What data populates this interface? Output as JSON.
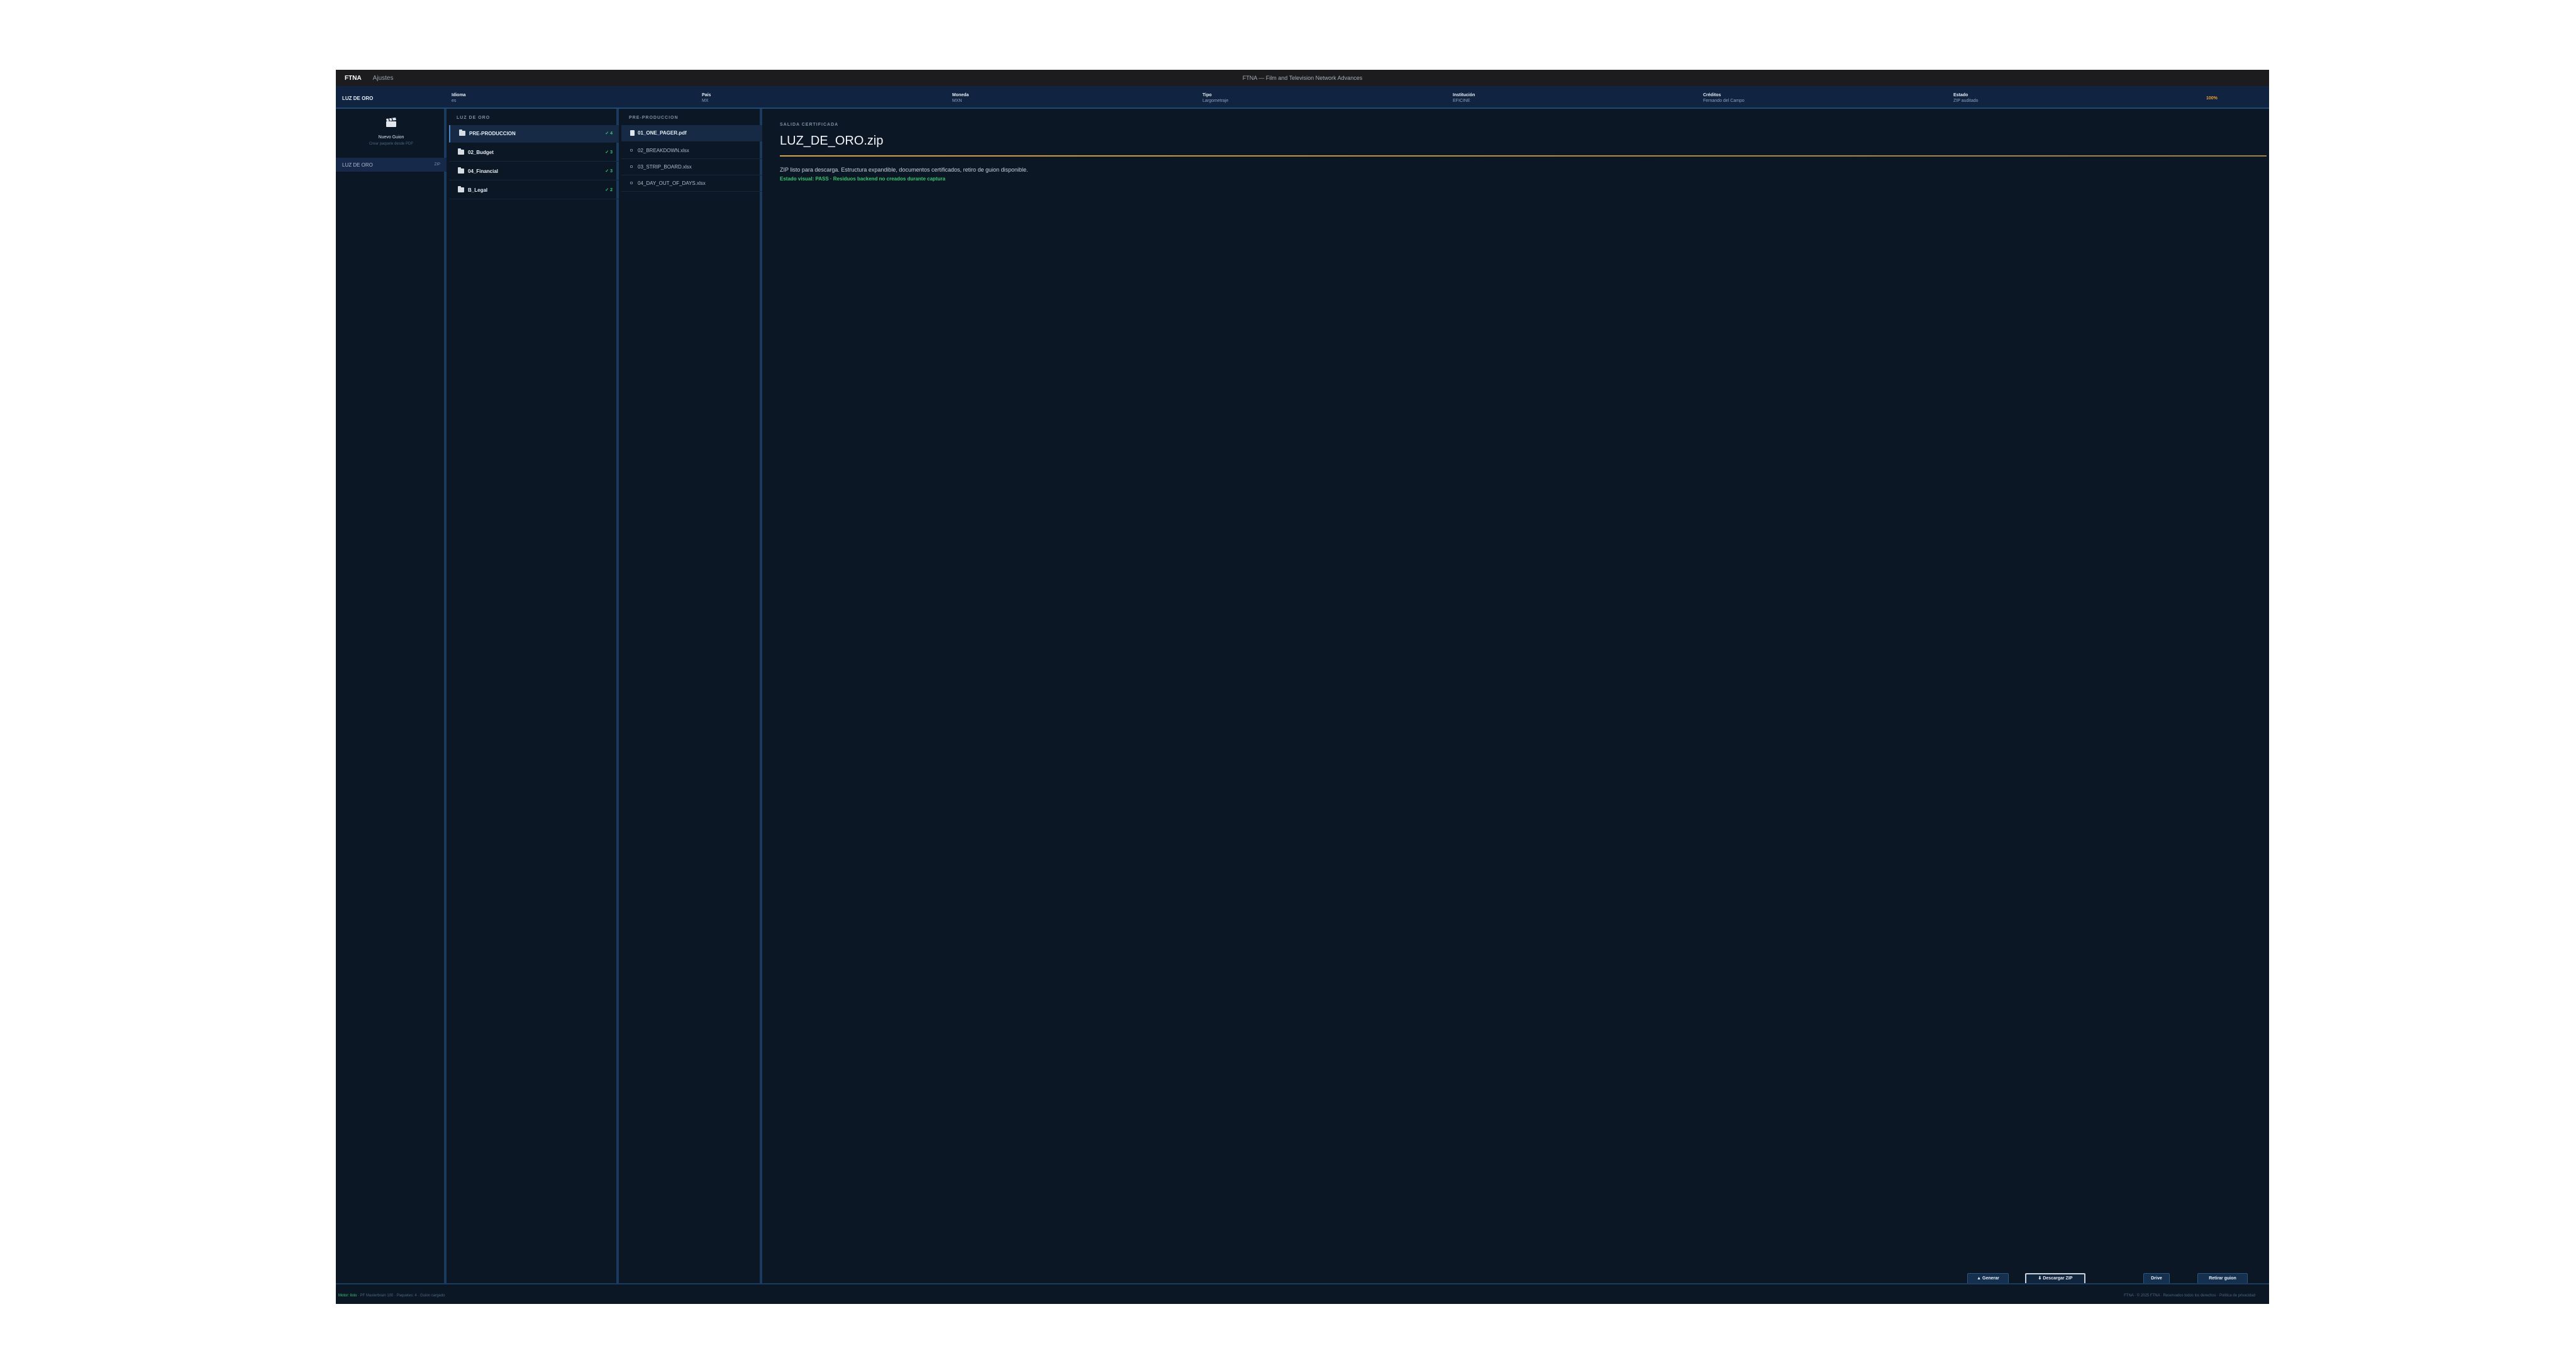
{
  "titlebar": {
    "brand": "FTNA",
    "menu_item": "Ajustes",
    "window_title": "FTNA — Film and Television Network Advances"
  },
  "infobar": {
    "project": "LUZ DE ORO",
    "fields": [
      {
        "label": "Idioma",
        "value": "es"
      },
      {
        "label": "País",
        "value": "MX"
      },
      {
        "label": "Moneda",
        "value": "MXN"
      },
      {
        "label": "Tipo",
        "value": "Largometraje"
      },
      {
        "label": "Institución",
        "value": "EFICINE"
      },
      {
        "label": "Créditos",
        "value": "Fernando del Campo"
      },
      {
        "label": "Estado",
        "value": "ZIP auditado"
      }
    ],
    "progress": "100%"
  },
  "sidebar": {
    "new_script_label": "Nuevo Guion",
    "new_script_sub": "Crear paquete desde PDF",
    "projects": [
      {
        "label": "LUZ DE ORO",
        "badge": "ZIP"
      }
    ]
  },
  "folders": {
    "heading": "LUZ DE ORO",
    "items": [
      {
        "name": "PRE-PRODUCCION",
        "check": "✓ 4"
      },
      {
        "name": "02_Budget",
        "check": "✓ 3"
      },
      {
        "name": "04_Financial",
        "check": "✓ 3"
      },
      {
        "name": "B_Legal",
        "check": "✓ 2"
      }
    ]
  },
  "files": {
    "heading": "PRE-PRODUCCION",
    "items": [
      {
        "name": "01_ONE_PAGER.pdf"
      },
      {
        "name": "02_BREAKDOWN.xlsx"
      },
      {
        "name": "03_STRIP_BOARD.xlsx"
      },
      {
        "name": "04_DAY_OUT_OF_DAYS.xlsx"
      }
    ]
  },
  "output": {
    "section_label": "SALIDA CERTIFICADA",
    "title": "LUZ_DE_ORO.zip",
    "description": "ZIP listo para descarga. Estructura expandible, documentos certificados, retiro de guion disponible.",
    "status": "Estado visual: PASS · Residuos backend no creados durante captura"
  },
  "actions": {
    "generate": "▲ Generar",
    "download": "⬇ Descargar ZIP",
    "drive": "Drive",
    "remove": "Retirar guion"
  },
  "footer": {
    "left_ok": "Motor: listo",
    "left_rest": "·  PF Masterbrain 100  ·  Paquetes: 4  ·  Guion cargado",
    "right": "FTNA · © 2025 FTNA  ·  Reservados todos los derechos  ·  Política de privacidad"
  },
  "colors": {
    "background": "#0c1726",
    "accent_gold": "#d9a441",
    "pass_green": "#36c86e",
    "progress_orange": "#f0a030"
  }
}
